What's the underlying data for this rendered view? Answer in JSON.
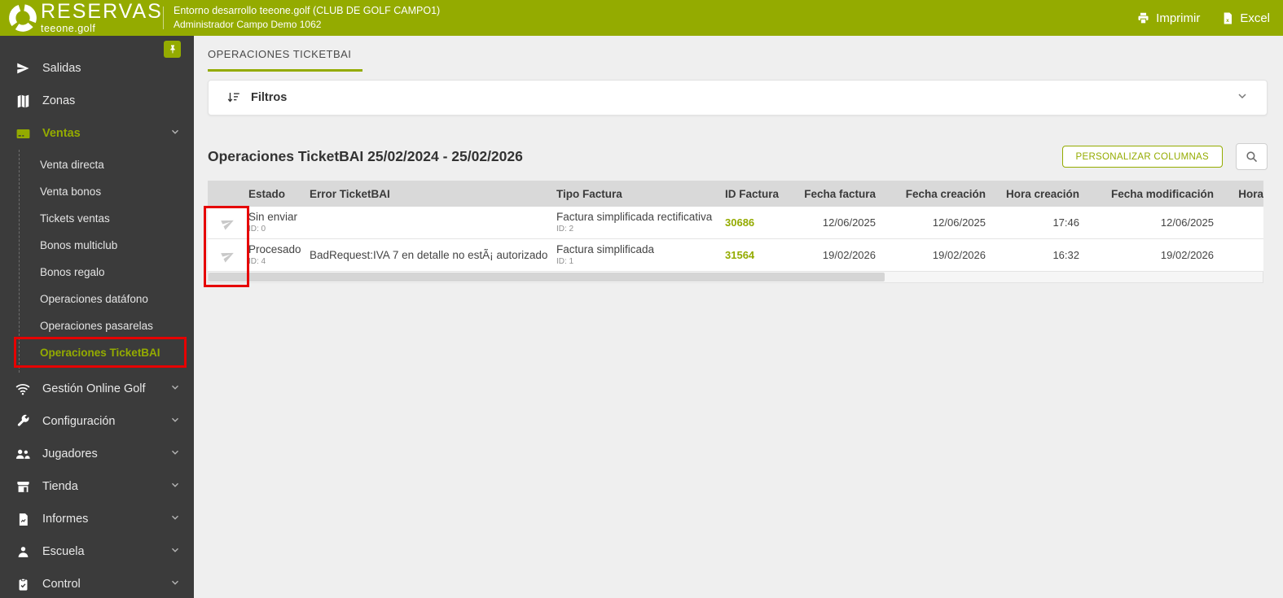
{
  "brand": {
    "name": "RESERVAS",
    "domain": "teeone.golf"
  },
  "topbar": {
    "env_line1": "Entorno desarrollo teeone.golf  (CLUB DE GOLF CAMPO1)",
    "env_line2": "Administrador Campo Demo 1062",
    "print_label": "Imprimir",
    "excel_label": "Excel"
  },
  "colors": {
    "accent": "#94ab00",
    "sidebar_bg": "#3b3b3b",
    "annotation_red": "#e60000"
  },
  "sidebar": {
    "items_top": [
      "Salidas",
      "Zonas",
      "Ventas"
    ],
    "ventas_sub": [
      "Venta directa",
      "Venta bonos",
      "Tickets ventas",
      "Bonos multiclub",
      "Bonos regalo",
      "Operaciones datáfono",
      "Operaciones pasarelas",
      "Operaciones TicketBAI"
    ],
    "items_bottom": [
      "Gestión Online Golf",
      "Configuración",
      "Jugadores",
      "Tienda",
      "Informes",
      "Escuela",
      "Control"
    ],
    "active_item": "Operaciones TicketBAI"
  },
  "tab": {
    "label": "OPERACIONES TICKETBAI"
  },
  "filters": {
    "label": "Filtros"
  },
  "content": {
    "title": "Operaciones TicketBAI 25/02/2024 - 25/02/2026",
    "customize_columns": "PERSONALIZAR COLUMNAS"
  },
  "table": {
    "columns": [
      "Estado",
      "Error TicketBAI",
      "Tipo Factura",
      "ID Factura",
      "Fecha factura",
      "Fecha creación",
      "Hora creación",
      "Fecha modificación",
      "Hora"
    ],
    "rows": [
      {
        "estado": "Sin enviar",
        "estado_id": "ID: 0",
        "error": "",
        "tipo": "Factura simplificada rectificativa",
        "tipo_id": "ID: 2",
        "id_factura": "30686",
        "fecha_factura": "12/06/2025",
        "fecha_creacion": "12/06/2025",
        "hora_creacion": "17:46",
        "fecha_modificacion": "12/06/2025"
      },
      {
        "estado": "Procesado",
        "estado_id": "ID: 4",
        "error": "BadRequest:IVA 7 en detalle no estÃ¡ autorizado",
        "tipo": "Factura simplificada",
        "tipo_id": "ID: 1",
        "id_factura": "31564",
        "fecha_factura": "19/02/2026",
        "fecha_creacion": "19/02/2026",
        "hora_creacion": "16:32",
        "fecha_modificacion": "19/02/2026"
      }
    ]
  }
}
